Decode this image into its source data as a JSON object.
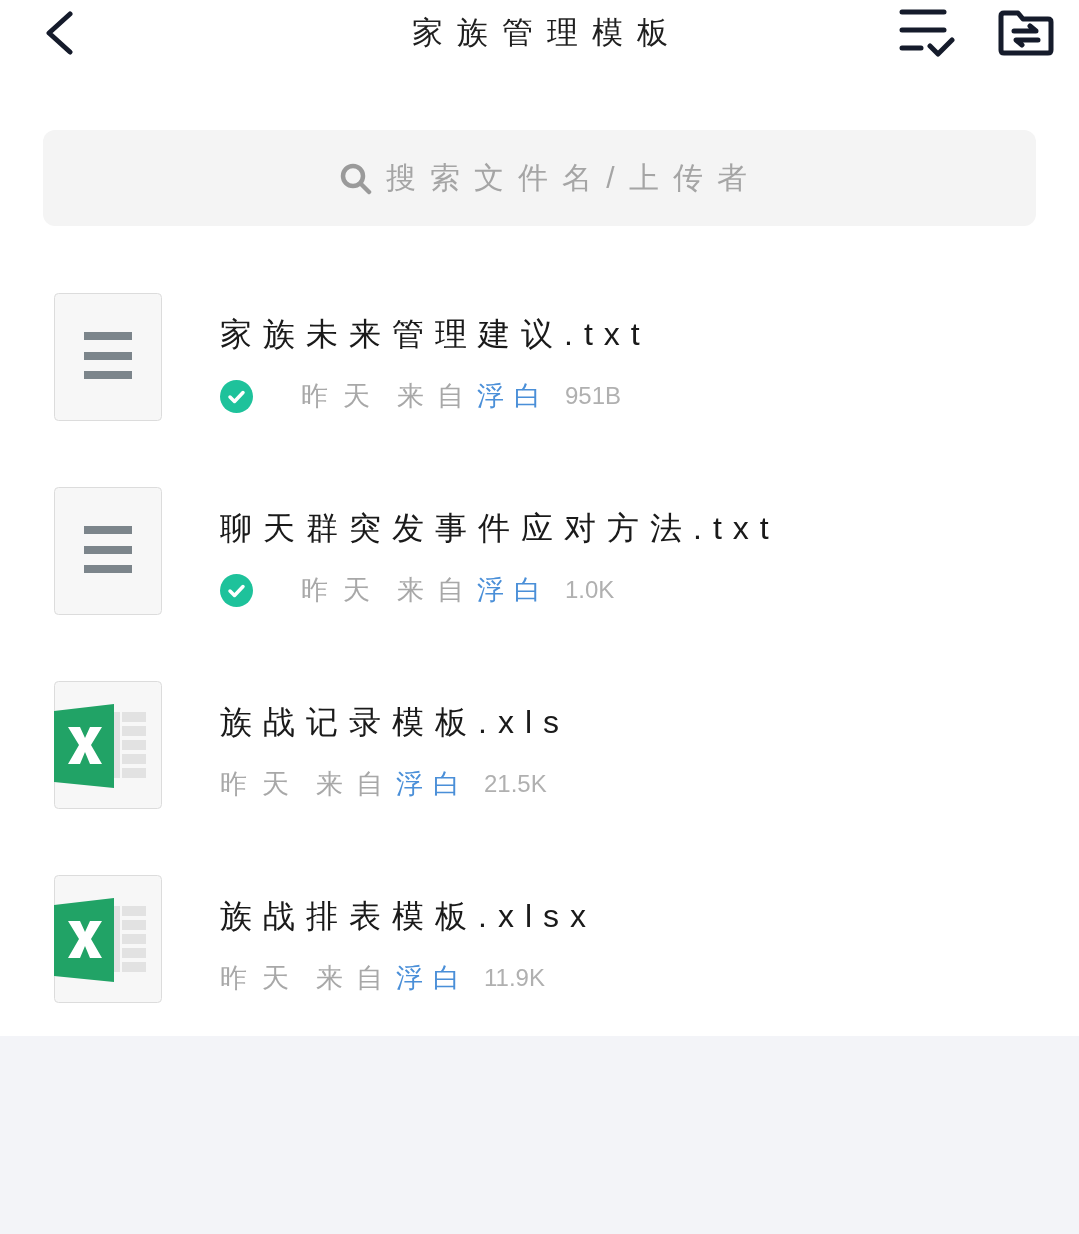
{
  "header": {
    "title": "家族管理模板"
  },
  "search": {
    "placeholder": "搜索文件名/上传者"
  },
  "files": [
    {
      "kind": "text",
      "name": "家族未来管理建议.txt",
      "synced": true,
      "date": "昨天",
      "source_label": "来自",
      "uploader": "浮白",
      "size": "951B"
    },
    {
      "kind": "text",
      "name": "聊天群突发事件应对方法.txt",
      "synced": true,
      "date": "昨天",
      "source_label": "来自",
      "uploader": "浮白",
      "size": "1.0K"
    },
    {
      "kind": "spreadsheet",
      "name": "族战记录模板.xls",
      "synced": false,
      "date": "昨天",
      "source_label": "来自",
      "uploader": "浮白",
      "size": "21.5K"
    },
    {
      "kind": "spreadsheet",
      "name": "族战排表模板.xlsx",
      "synced": false,
      "date": "昨天",
      "source_label": "来自",
      "uploader": "浮白",
      "size": "11.9K"
    }
  ]
}
